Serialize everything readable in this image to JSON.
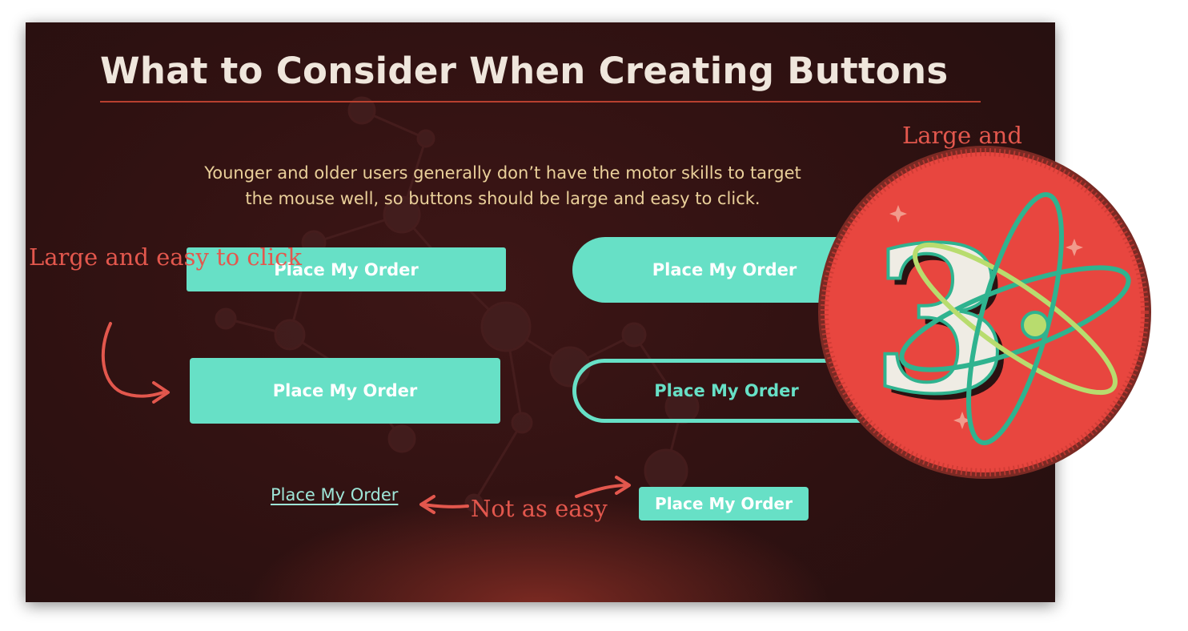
{
  "slide": {
    "title": "What to Consider When Creating Buttons",
    "intro": "Younger and older users generally don’t have the motor skills to target the mouse well, so buttons should be large and easy to click."
  },
  "buttons": {
    "square_small": "Place My Order",
    "rounded_pill": "Place My Order",
    "square_large": "Place My Order",
    "outlined_pill": "Place My Order",
    "compact": "Place My Order",
    "text_link": "Place My Order"
  },
  "annotations": {
    "large_easy": "Large and easy to click",
    "not_easy": "Not as easy",
    "badge_caption": "Large and"
  },
  "badge": {
    "numeral": "3"
  },
  "colors": {
    "background": "#2f1111",
    "accent": "#67e0c6",
    "annotation": "#e3574d",
    "title": "#efe6dc",
    "intro": "#ead09a",
    "badge": "#e8463f"
  }
}
